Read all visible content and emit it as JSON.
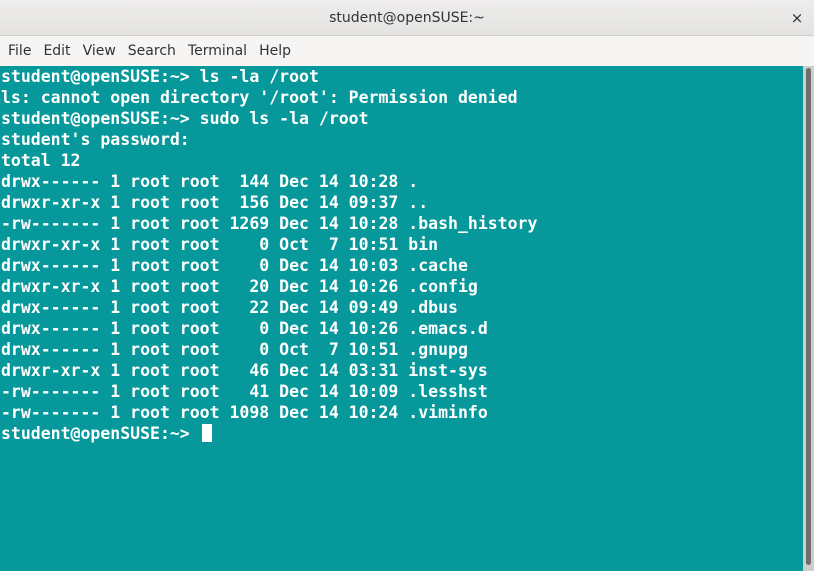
{
  "window": {
    "title": "student@openSUSE:~",
    "close_glyph": "×",
    "close_icon": "close-icon"
  },
  "menu": {
    "items": [
      "File",
      "Edit",
      "View",
      "Search",
      "Terminal",
      "Help"
    ]
  },
  "terminal": {
    "background": "#06989a",
    "foreground": "#ffffff",
    "lines": [
      "student@openSUSE:~> ls -la /root",
      "ls: cannot open directory '/root': Permission denied",
      "student@openSUSE:~> sudo ls -la /root",
      "student's password:",
      "total 12",
      "drwx------ 1 root root  144 Dec 14 10:28 .",
      "drwxr-xr-x 1 root root  156 Dec 14 09:37 ..",
      "-rw------- 1 root root 1269 Dec 14 10:28 .bash_history",
      "drwxr-xr-x 1 root root    0 Oct  7 10:51 bin",
      "drwx------ 1 root root    0 Dec 14 10:03 .cache",
      "drwxr-xr-x 1 root root   20 Dec 14 10:26 .config",
      "drwx------ 1 root root   22 Dec 14 09:49 .dbus",
      "drwx------ 1 root root    0 Dec 14 10:26 .emacs.d",
      "drwx------ 1 root root    0 Oct  7 10:51 .gnupg",
      "drwxr-xr-x 1 root root   46 Dec 14 03:31 inst-sys",
      "-rw------- 1 root root   41 Dec 14 10:09 .lesshst",
      "-rw------- 1 root root 1098 Dec 14 10:24 .viminfo"
    ],
    "prompt": "student@openSUSE:~> "
  }
}
